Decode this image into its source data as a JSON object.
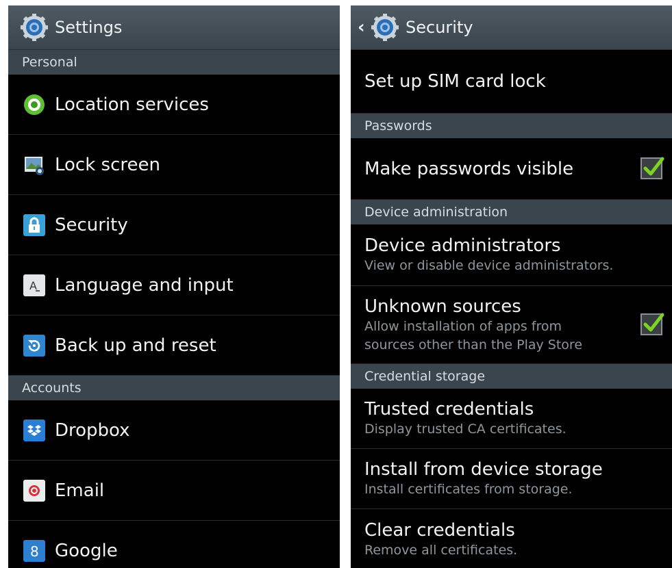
{
  "left": {
    "title": "Settings",
    "sections": {
      "personal": "Personal",
      "accounts": "Accounts"
    },
    "items": [
      {
        "label": "Location services",
        "icon": "location-icon"
      },
      {
        "label": "Lock screen",
        "icon": "lock-screen-icon"
      },
      {
        "label": "Security",
        "icon": "padlock-icon"
      },
      {
        "label": "Language and input",
        "icon": "language-icon"
      },
      {
        "label": "Back up and reset",
        "icon": "backup-icon"
      },
      {
        "label": "Dropbox",
        "icon": "dropbox-icon"
      },
      {
        "label": "Email",
        "icon": "email-icon"
      },
      {
        "label": "Google",
        "icon": "google-icon"
      }
    ]
  },
  "right": {
    "title": "Security",
    "sim_lock": "Set up SIM card lock",
    "sections": {
      "passwords": "Passwords",
      "device_admin": "Device administration",
      "credential_storage": "Credential storage"
    },
    "make_passwords_visible": {
      "label": "Make passwords visible",
      "checked": true
    },
    "device_administrators": {
      "label": "Device administrators",
      "sub": "View or disable device administrators."
    },
    "unknown_sources": {
      "label": "Unknown sources",
      "sub1": "Allow installation of apps from",
      "sub2": "sources other than the Play Store",
      "checked": true
    },
    "trusted_credentials": {
      "label": "Trusted credentials",
      "sub": "Display trusted CA certificates."
    },
    "install_from_storage": {
      "label": "Install from device storage",
      "sub": "Install certificates from storage."
    },
    "clear_credentials": {
      "label": "Clear credentials",
      "sub": "Remove all certificates."
    }
  },
  "colors": {
    "actionbar": "#3f4a52",
    "section": "#3b454d",
    "check": "#7dd321"
  }
}
